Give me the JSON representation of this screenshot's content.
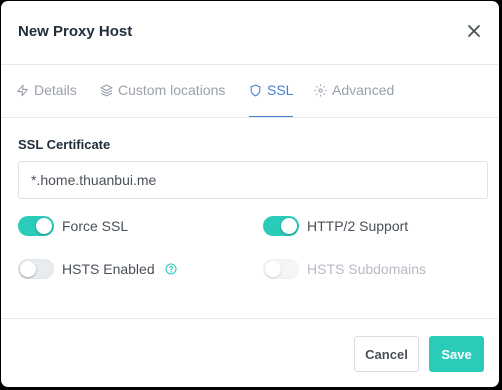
{
  "modal": {
    "title": "New Proxy Host"
  },
  "tabs": [
    {
      "label": "Details",
      "icon": "zap-icon",
      "active": false
    },
    {
      "label": "Custom locations",
      "icon": "layers-icon",
      "active": false
    },
    {
      "label": "SSL",
      "icon": "shield-icon",
      "active": true
    },
    {
      "label": "Advanced",
      "icon": "gear-icon",
      "active": false
    }
  ],
  "ssl": {
    "certificate_label": "SSL Certificate",
    "certificate_value": "*.home.thuanbui.me",
    "force_ssl": {
      "label": "Force SSL",
      "on": true
    },
    "http2": {
      "label": "HTTP/2 Support",
      "on": true
    },
    "hsts": {
      "label": "HSTS Enabled",
      "on": false
    },
    "hsts_subdomains": {
      "label": "HSTS Subdomains",
      "on": false,
      "disabled": true
    }
  },
  "footer": {
    "cancel_label": "Cancel",
    "save_label": "Save"
  },
  "colors": {
    "accent": "#2bcbba",
    "active_tab": "#467fcf",
    "muted": "#9aa0ac"
  }
}
